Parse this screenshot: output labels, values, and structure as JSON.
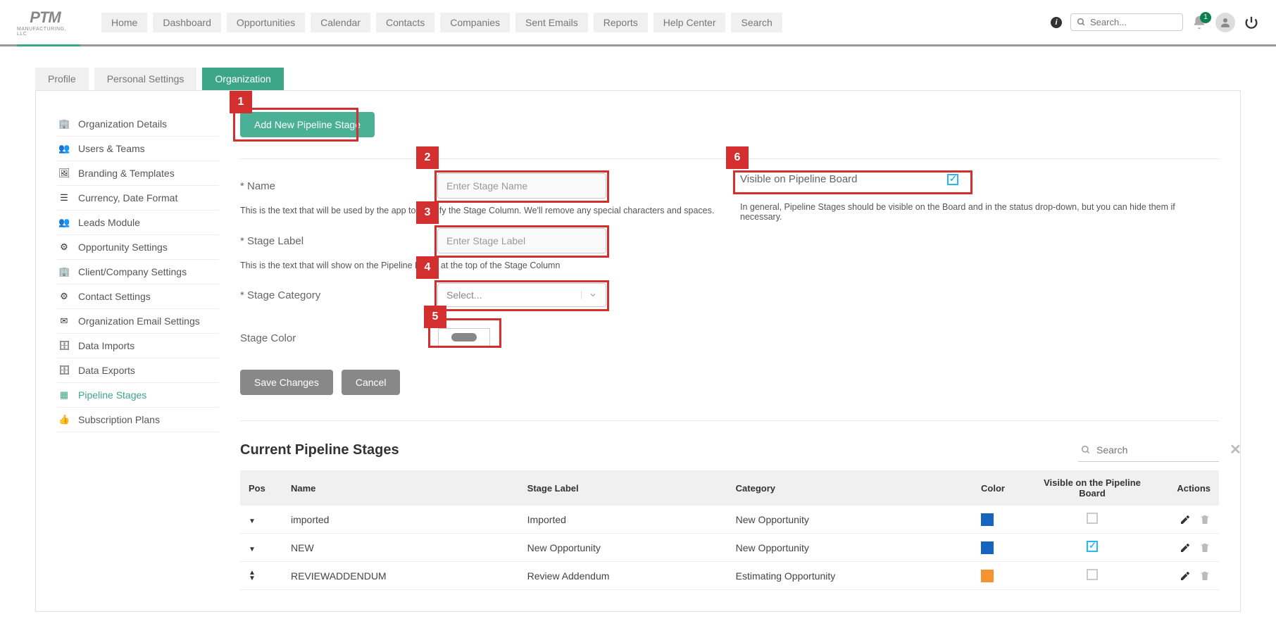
{
  "logo": {
    "main": "PTM",
    "sub": "MANUFACTURING, LLC"
  },
  "nav": [
    "Home",
    "Dashboard",
    "Opportunities",
    "Calendar",
    "Contacts",
    "Companies",
    "Sent Emails",
    "Reports",
    "Help Center",
    "Search"
  ],
  "search_placeholder": "Search...",
  "badge_count": "1",
  "tabs": [
    {
      "label": "Profile",
      "active": false
    },
    {
      "label": "Personal Settings",
      "active": false
    },
    {
      "label": "Organization",
      "active": true
    }
  ],
  "sidebar": [
    {
      "label": "Organization Details",
      "icon": "building"
    },
    {
      "label": "Users & Teams",
      "icon": "users"
    },
    {
      "label": "Branding & Templates",
      "icon": "image"
    },
    {
      "label": "Currency, Date Format",
      "icon": "list"
    },
    {
      "label": "Leads Module",
      "icon": "users"
    },
    {
      "label": "Opportunity Settings",
      "icon": "user-cog"
    },
    {
      "label": "Client/Company Settings",
      "icon": "building"
    },
    {
      "label": "Contact Settings",
      "icon": "user-cog"
    },
    {
      "label": "Organization Email Settings",
      "icon": "envelope"
    },
    {
      "label": "Data Imports",
      "icon": "database"
    },
    {
      "label": "Data Exports",
      "icon": "database"
    },
    {
      "label": "Pipeline Stages",
      "icon": "columns",
      "active": true
    },
    {
      "label": "Subscription Plans",
      "icon": "thumbs-up"
    }
  ],
  "add_button": "Add New Pipeline Stage",
  "form": {
    "name_label": "* Name",
    "name_placeholder": "Enter Stage Name",
    "name_help": "This is the text that will be used by the app to identify the Stage Column. We'll remove any special characters and spaces.",
    "stage_label_label": "* Stage Label",
    "stage_label_placeholder": "Enter Stage Label",
    "stage_label_help": "This is the text that will show on the Pipeline Board at the top of the Stage Column",
    "category_label": "* Stage Category",
    "category_placeholder": "Select...",
    "color_label": "Stage Color",
    "visible_label": "Visible on Pipeline Board",
    "visible_help": "In general, Pipeline Stages should be visible on the Board and in the status drop-down, but you can hide them if necessary.",
    "save": "Save Changes",
    "cancel": "Cancel"
  },
  "markers": {
    "1": "1",
    "2": "2",
    "3": "3",
    "4": "4",
    "5": "5",
    "6": "6"
  },
  "table": {
    "title": "Current Pipeline Stages",
    "search_placeholder": "Search",
    "headers": [
      "Pos",
      "Name",
      "Stage Label",
      "Category",
      "Color",
      "Visible on the Pipeline Board",
      "Actions"
    ],
    "rows": [
      {
        "pos": "down",
        "name": "imported",
        "label": "Imported",
        "category": "New Opportunity",
        "color": "#1565c0",
        "visible": false
      },
      {
        "pos": "down",
        "name": "NEW",
        "label": "New Opportunity",
        "category": "New Opportunity",
        "color": "#1565c0",
        "visible": true
      },
      {
        "pos": "both",
        "name": "REVIEWADDENDUM",
        "label": "Review Addendum",
        "category": "Estimating Opportunity",
        "color": "#f59331",
        "visible": false
      }
    ]
  }
}
